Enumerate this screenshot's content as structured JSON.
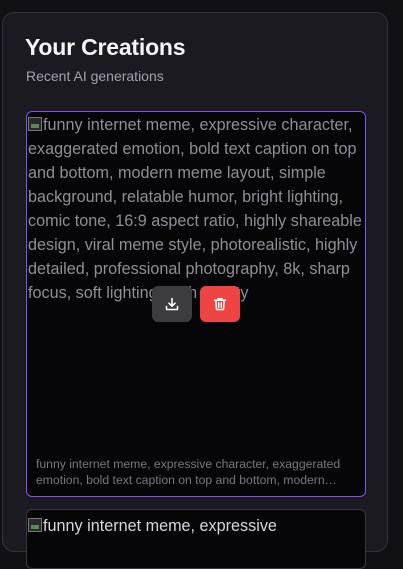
{
  "header": {
    "title": "Your Creations",
    "subtitle": "Recent AI generations"
  },
  "creations": [
    {
      "alt_text": "funny internet meme, expressive character, exaggerated emotion, bold text caption on top and bottom, modern meme layout, simple background, relatable humor, bright lighting, comic tone, 16:9 aspect ratio, highly shareable design, viral meme style, photorealistic, highly detailed, professional photography, 8k, sharp focus, soft lighting, high quality",
      "caption": "funny internet meme, expressive character, exaggerated emotion, bold text caption on top and bottom, modern meme layout, simple background, relatable humor, bright lighting, comic tone, 16:9 aspect ratio, highly shareable design, viral meme style, photorealistic, highly detailed, professional photography, 8k, sharp focus, soft lighting, high quality",
      "download_icon": "download-icon",
      "delete_icon": "trash-icon",
      "accent_color": "#8b4cf0",
      "delete_color": "#ef4444"
    },
    {
      "alt_text": "funny internet meme, expressive"
    }
  ]
}
